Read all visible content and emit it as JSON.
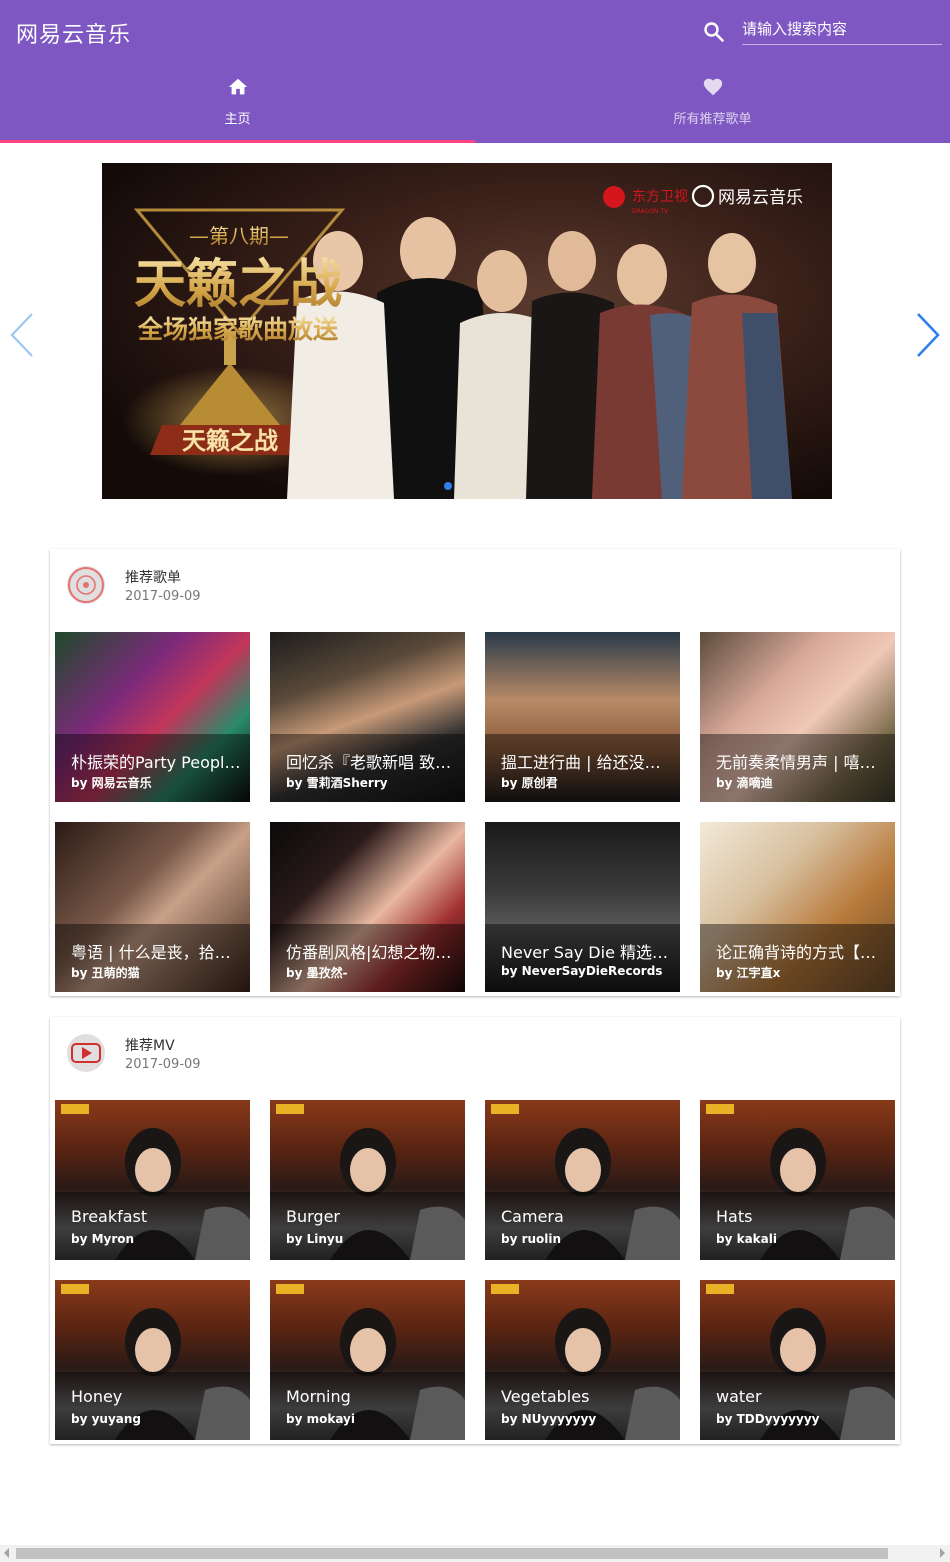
{
  "app": {
    "title": "网易云音乐"
  },
  "search": {
    "placeholder": "请输入搜索内容",
    "icon": "search-icon"
  },
  "tabs": [
    {
      "label": "主页",
      "icon": "home-icon",
      "active": true
    },
    {
      "label": "所有推荐歌单",
      "icon": "heart-icon",
      "active": false
    }
  ],
  "banner": {
    "channel_label": "东方卫视",
    "channel_sub": "DRAGON TV",
    "brand_label": "网易云音乐",
    "issue": "—第八期—",
    "headline": "天籁之战",
    "subline": "全场独家歌曲放送",
    "trophy_text": "天籁之战",
    "dots": 1,
    "active_dot": 0
  },
  "playlists": {
    "title": "推荐歌单",
    "date": "2017-09-09",
    "items": [
      {
        "title": "朴振荣的Party People…",
        "by": "网易云音乐"
      },
      {
        "title": "回忆杀『老歌新唱 致敬…",
        "by": "雪莉酒Sherry"
      },
      {
        "title": "搵工进行曲 | 给还没有O…",
        "by": "原创君"
      },
      {
        "title": "无前奏柔情男声 | 嘻嚣…",
        "by": "滴嘀迪"
      },
      {
        "title": "粤语 | 什么是丧，拾起…",
        "by": "丑萌的猫"
      },
      {
        "title": "仿番剧风格|幻想之物语…",
        "by": "墨孜然-"
      },
      {
        "title": "Never Say Die 精选歌单",
        "by": "NeverSayDieRecords"
      },
      {
        "title": "论正确背诗的方式【文…",
        "by": "江宇直x"
      }
    ]
  },
  "mvs": {
    "title": "推荐MV",
    "date": "2017-09-09",
    "items": [
      {
        "title": "Breakfast",
        "by": "Myron"
      },
      {
        "title": "Burger",
        "by": "Linyu"
      },
      {
        "title": "Camera",
        "by": "ruolin"
      },
      {
        "title": "Hats",
        "by": "kakali"
      },
      {
        "title": "Honey",
        "by": "yuyang"
      },
      {
        "title": "Morning",
        "by": "mokayi"
      },
      {
        "title": "Vegetables",
        "by": "NUyyyyyyy"
      },
      {
        "title": "water",
        "by": "TDDyyyyyyy"
      }
    ]
  },
  "colors": {
    "appbar": "#7e57c2",
    "indicator": "#ff4081",
    "dot": "#2f80ed",
    "avatar_red": "#d32f2f"
  }
}
